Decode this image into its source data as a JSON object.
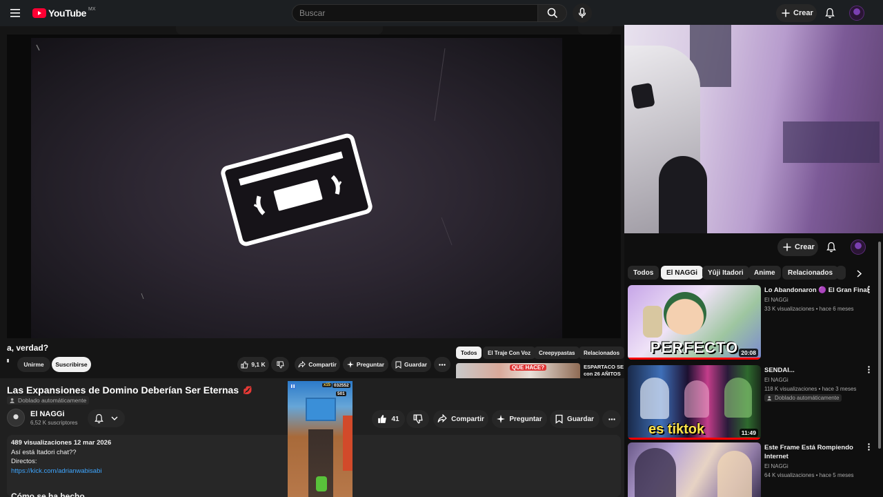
{
  "masthead": {
    "logo_text": "YouTube",
    "country_code": "MX",
    "search_placeholder": "Buscar",
    "create_label": "Crear"
  },
  "player": {
    "partial_title": "a, verdad?",
    "join_label": "Unirme",
    "subscribe_label": "Suscribirse",
    "likes": "9,1 K",
    "share_label": "Compartir",
    "ask_label": "Preguntar",
    "save_label": "Guardar",
    "chips": [
      "Todos",
      "El Traje Con Voz",
      "Creepypastas",
      "Relacionados"
    ],
    "mini_card_title_1": "ESPARTACO SE",
    "mini_card_title_2": "con 26 AÑITOS",
    "mini_thumb_text": "QUE HACE?"
  },
  "video": {
    "title": "Las Expansiones de Domino Deberían Ser Eternas",
    "title_emoji": "💋",
    "dubbed_label": "Doblado automáticamente",
    "channel_name": "El NAGGi",
    "channel_subs": "6,52 K suscriptores",
    "likes": "41",
    "share_label": "Compartir",
    "ask_label": "Preguntar",
    "save_label": "Guardar"
  },
  "description": {
    "stats": "489 visualizaciones  12 mar 2026",
    "line1": "Así está Itadori chat??",
    "line2": "Directos:",
    "link": "https://kick.com/adrianwabisabi",
    "heading": "Cómo se ha hecho"
  },
  "game_overlay": {
    "score": "032552",
    "multiplier": "x15",
    "coins": "501"
  },
  "right_panel": {
    "create_label": "Crear",
    "chips": [
      "Todos",
      "El NAGGi",
      "Yûji Itadori",
      "Anime",
      "Relacionados"
    ],
    "active_chip_index": 1,
    "videos": [
      {
        "title": "Lo Abandonaron 🟣 El Gran Final",
        "channel": "El NAGGi",
        "meta": "33 K visualizaciones • hace 6 meses",
        "duration": "20:08",
        "thumb_text": "PERFECTO",
        "dubbed": ""
      },
      {
        "title": "SENDAI...",
        "channel": "El NAGGi",
        "meta": "118 K visualizaciones • hace 3 meses",
        "duration": "11:49",
        "thumb_text": "es tiktok",
        "dubbed": "Doblado automáticamente"
      },
      {
        "title": "Este Frame Está Rompiendo Internet",
        "channel": "El NAGGi",
        "meta": "64 K visualizaciones • hace 5 meses",
        "duration": "",
        "thumb_text": "",
        "dubbed": ""
      }
    ]
  },
  "colors": {
    "brand_red": "#ff0033",
    "link_blue": "#3ea6ff",
    "progress_red": "#ff0000"
  }
}
